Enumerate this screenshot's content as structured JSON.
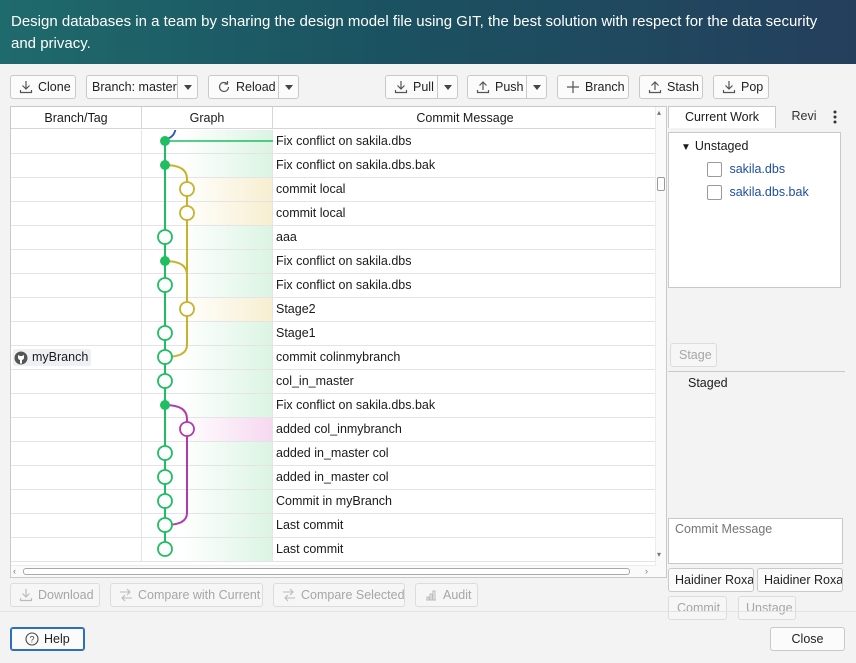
{
  "header": {
    "text": "Design databases in a team by sharing the design model file using GIT, the best solution with respect for the data security and privacy."
  },
  "toolbar": {
    "clone": "Clone",
    "branch": "Branch: master",
    "reload": "Reload",
    "pull": "Pull",
    "push": "Push",
    "branch_btn": "Branch",
    "stash": "Stash",
    "pop": "Pop"
  },
  "columns": {
    "branch": "Branch/Tag",
    "graph": "Graph",
    "message": "Commit Message"
  },
  "commits": [
    {
      "branch": "",
      "message": "Fix conflict on sakila.dbs"
    },
    {
      "branch": "",
      "message": "Fix conflict on sakila.dbs.bak"
    },
    {
      "branch": "",
      "message": "commit local"
    },
    {
      "branch": "",
      "message": "commit local"
    },
    {
      "branch": "",
      "message": "aaa"
    },
    {
      "branch": "",
      "message": "Fix conflict on sakila.dbs"
    },
    {
      "branch": "",
      "message": "Fix conflict on sakila.dbs"
    },
    {
      "branch": "",
      "message": "Stage2"
    },
    {
      "branch": "",
      "message": "Stage1"
    },
    {
      "branch": "myBranch",
      "message": "commit colinmybranch"
    },
    {
      "branch": "",
      "message": "col_in_master"
    },
    {
      "branch": "",
      "message": "Fix conflict on sakila.dbs.bak"
    },
    {
      "branch": "",
      "message": "added col_inmybranch"
    },
    {
      "branch": "",
      "message": "added in_master col"
    },
    {
      "branch": "",
      "message": "added in_master col"
    },
    {
      "branch": "",
      "message": "Commit in myBranch"
    },
    {
      "branch": "",
      "message": "Last commit"
    },
    {
      "branch": "",
      "message": "Last commit"
    }
  ],
  "right_panel": {
    "tab_current": "Current Work",
    "tab_review": "Revi",
    "unstaged_label": "Unstaged",
    "unstaged_files": [
      "sakila.dbs",
      "sakila.dbs.bak"
    ],
    "stage_button": "Stage",
    "staged_label": "Staged",
    "commit_placeholder": "Commit Message",
    "author_name": "Haidiner Roxa",
    "author_email": "Haidiner Roxa",
    "commit_button": "Commit",
    "unstage_button": "Unstage"
  },
  "actions": {
    "download": "Download",
    "compare_current": "Compare with Current",
    "compare_selected": "Compare Selected",
    "audit": "Audit"
  },
  "footer": {
    "help": "Help",
    "close": "Close"
  }
}
